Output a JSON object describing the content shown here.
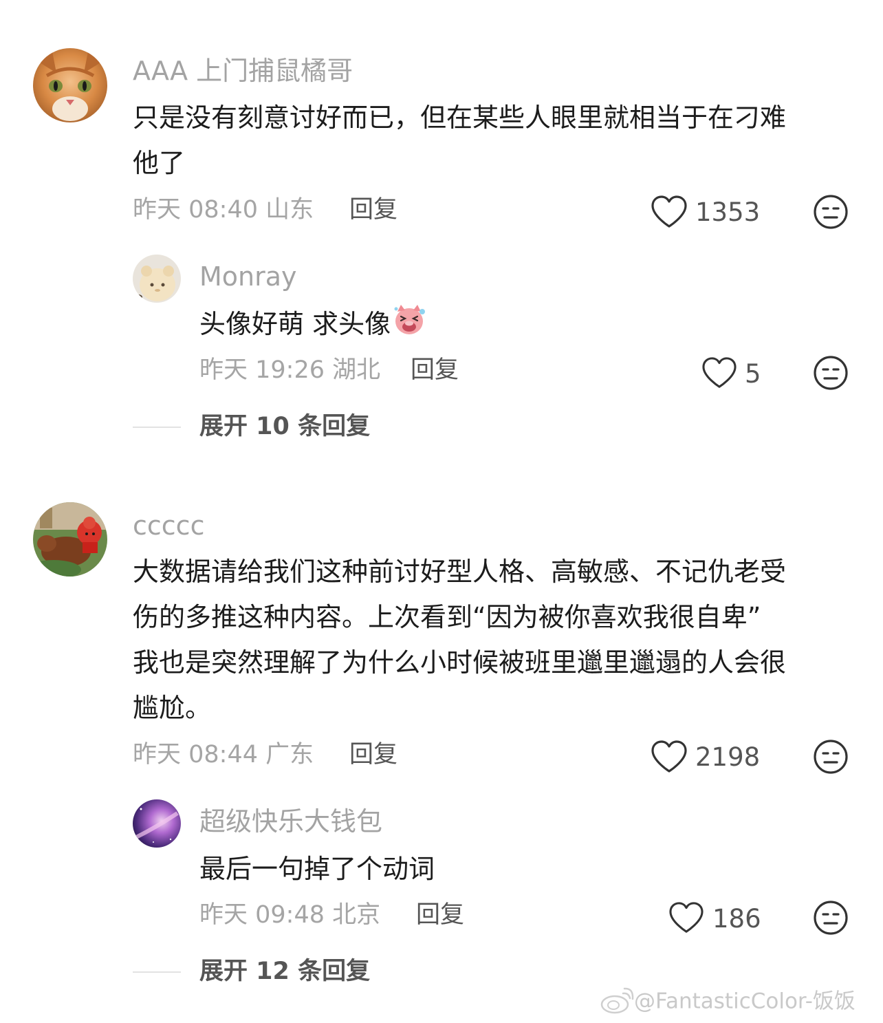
{
  "comments": [
    {
      "username": "AAA 上门捕鼠橘哥",
      "avatar": "orange-cat-avatar",
      "lines": [
        "只是没有刻意讨好而已，但在某些人眼里就相当于在刁难",
        "他了"
      ],
      "time": "昨天 08:40 山东",
      "reply_label": "回复",
      "likes": "1353",
      "replies": [
        {
          "username": "Monray",
          "avatar": "plush-toy-avatar",
          "text": "头像好萌 求头像",
          "emoji": "laughing-pig-emoji",
          "time": "昨天 19:26 湖北",
          "reply_label": "回复",
          "likes": "5"
        }
      ],
      "expand_label": "展开 10 条回复"
    },
    {
      "username": "ccccc",
      "avatar": "cartoon-rider-avatar",
      "lines": [
        "大数据请给我们这种前讨好型人格、高敏感、不记仇老受",
        "伤的多推这种内容。上次看到“因为被你喜欢我很自卑”",
        "我也是突然理解了为什么小时候被班里邋里邋遢的人会很",
        "尴尬。"
      ],
      "time": "昨天 08:44 广东",
      "reply_label": "回复",
      "likes": "2198",
      "replies": [
        {
          "username": "超级快乐大钱包",
          "avatar": "galaxy-avatar",
          "text": "最后一句掉了个动词",
          "time": "昨天 09:48 北京",
          "reply_label": "回复",
          "likes": "186"
        }
      ],
      "expand_label": "展开 12 条回复"
    }
  ],
  "watermark": "@FantasticColor-饭饭",
  "colors": {
    "text": "#1c1c1c",
    "muted": "#a3a3a3",
    "secondary": "#555555",
    "divider": "#e2e2e2"
  },
  "icons": [
    "heart-icon",
    "dislike-face-icon",
    "weibo-logo-icon"
  ]
}
